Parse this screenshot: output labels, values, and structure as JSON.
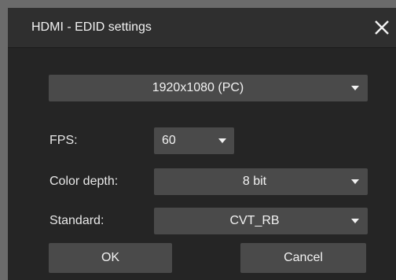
{
  "dialog": {
    "title": "HDMI - EDID settings",
    "close_icon": "close-icon"
  },
  "resolution": {
    "value": "1920x1080 (PC)"
  },
  "fps": {
    "label": "FPS:",
    "value": "60"
  },
  "color_depth": {
    "label": "Color depth:",
    "value": "8 bit"
  },
  "standard": {
    "label": "Standard:",
    "value": "CVT_RB"
  },
  "buttons": {
    "ok": "OK",
    "cancel": "Cancel"
  }
}
